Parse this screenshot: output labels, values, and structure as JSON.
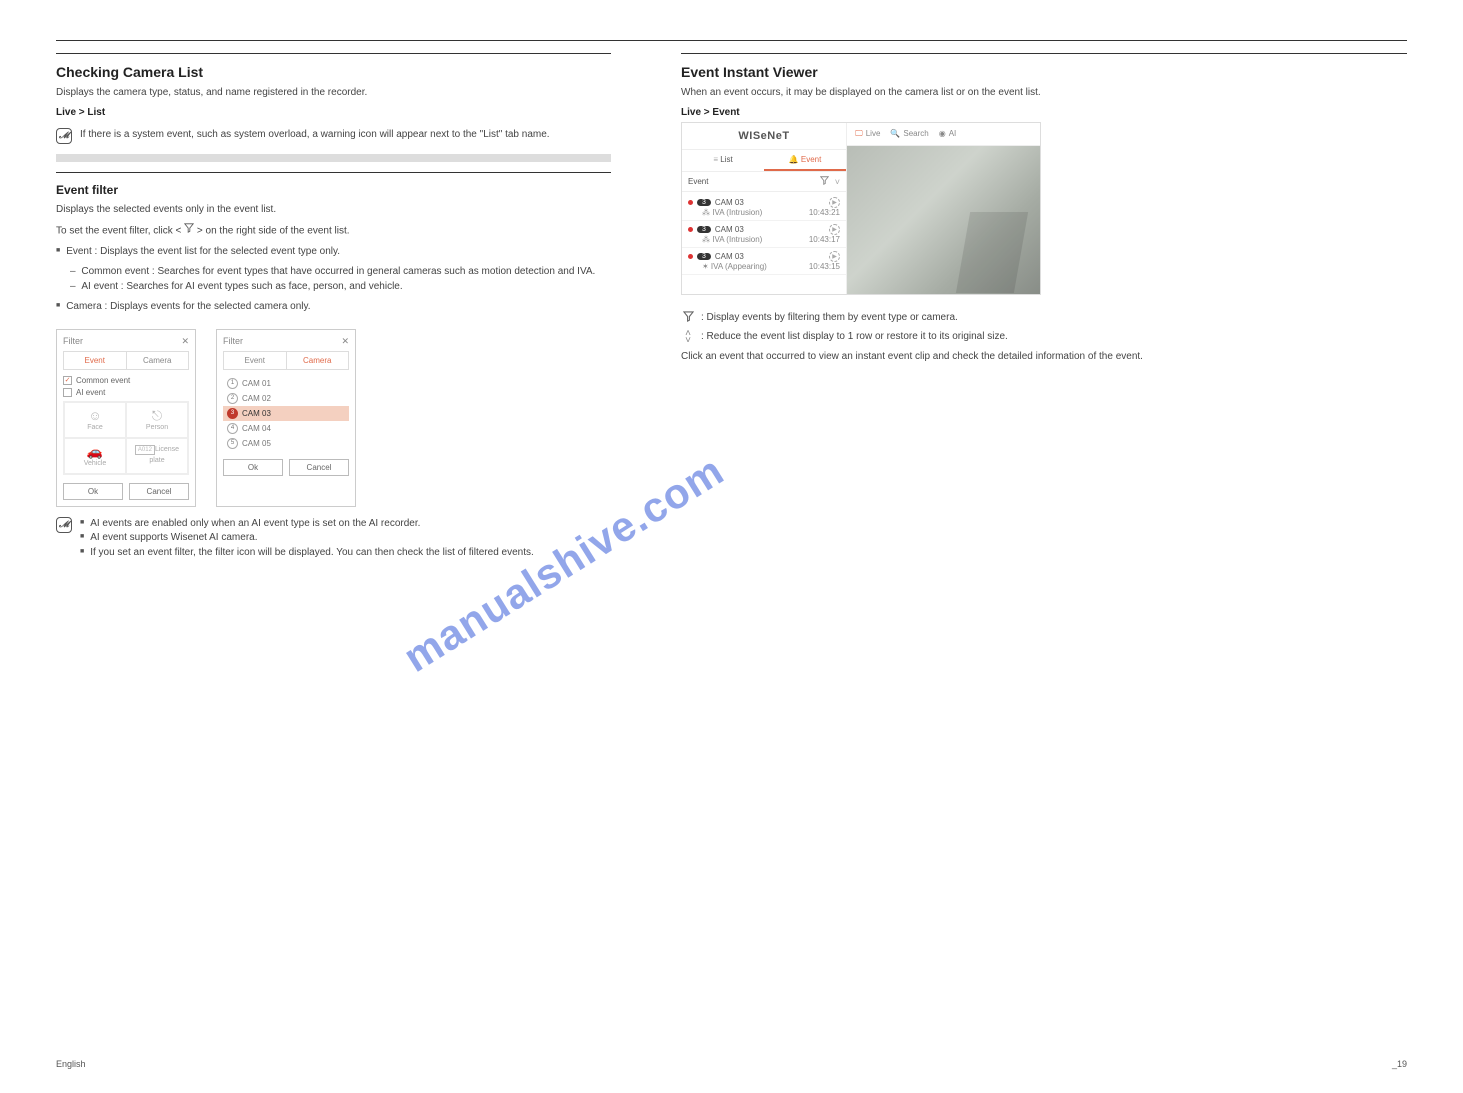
{
  "left": {
    "title": "Checking Camera List",
    "p1": "Displays the camera type, status, and name registered in the recorder.",
    "nav": "Live > List",
    "note1": "If there is a system event, such as system overload, a warning icon will appear next to the \"List\" tab name.",
    "filter": {
      "heading": "Event filter",
      "desc": "Displays the selected events only in the event list.",
      "setfilter_line": "To set the event filter, click < > on the right side of the event list.",
      "bullets": {
        "event_label": "Event : Displays the event list for the selected event type only.",
        "common_label": "Common event : Searches for event types that have occurred in general cameras such as motion detection and IVA.",
        "ai_label": "AI event : Searches for AI event types such as face, person, and vehicle.",
        "camera_label": "Camera : Displays events for the selected camera only."
      },
      "panel1": {
        "title": "Filter",
        "tab_event": "Event",
        "tab_camera": "Camera",
        "common_event": "Common event",
        "ai_event": "AI event",
        "icons": {
          "face": "Face",
          "person": "Person",
          "vehicle": "Vehicle",
          "lp": "License plate",
          "lp_badge": "A012"
        },
        "ok": "Ok",
        "cancel": "Cancel"
      },
      "panel2": {
        "title": "Filter",
        "tab_event": "Event",
        "tab_camera": "Camera",
        "cams": [
          "CAM 01",
          "CAM 02",
          "CAM 03",
          "CAM 04",
          "CAM 05"
        ],
        "ok": "Ok",
        "cancel": "Cancel"
      }
    },
    "note2_line1": "AI events are enabled only when an AI event type is set on the AI recorder.",
    "note2_line2": "AI event supports Wisenet AI camera.",
    "note2_line3": "If you set an event filter, the filter icon will be displayed. You can then check the list of filtered events."
  },
  "right": {
    "title": "Event Instant Viewer",
    "p1": "When an event occurs, it may be displayed on the camera list or on the event list.",
    "nav": "Live > Event",
    "ui": {
      "brand": "WISeNeT",
      "list_tab": "List",
      "event_tab": "Event",
      "event_label": "Event",
      "top_live": "Live",
      "top_search": "Search",
      "top_ai": "AI",
      "events": [
        {
          "cam": "CAM 03",
          "type": "IVA (Intrusion)",
          "time": "10:43:21"
        },
        {
          "cam": "CAM 03",
          "type": "IVA (Intrusion)",
          "time": "10:43:17"
        },
        {
          "cam": "CAM 03",
          "type": "IVA (Appearing)",
          "time": "10:43:15"
        }
      ]
    },
    "legend": {
      "filter": ": Display events by filtering them by event type or camera.",
      "collapse": ": Reduce the event list display to 1 row or restore it to its original size.",
      "body": "Click an event that occurred to view an instant event clip and check the detailed information of the event."
    }
  },
  "footer": {
    "left": "English",
    "right": "_19"
  },
  "watermark": "manualshive.com"
}
